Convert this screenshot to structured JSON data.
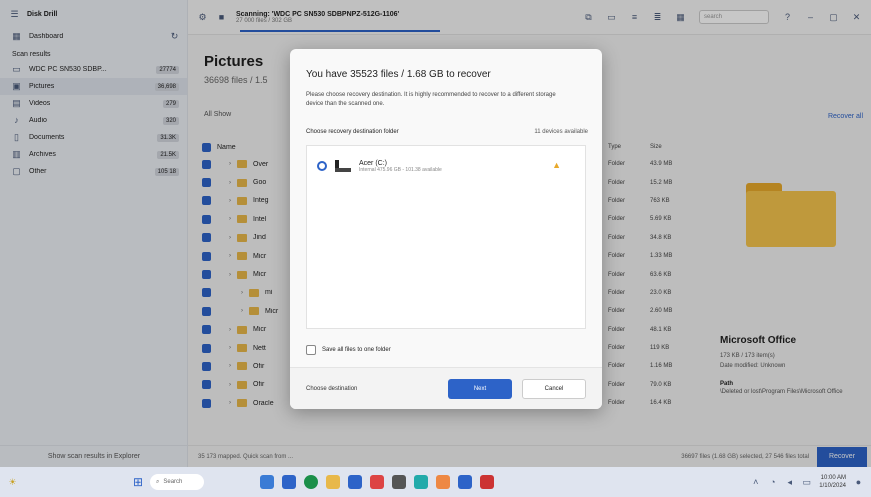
{
  "app": {
    "name": "Disk Drill",
    "scan_title": "Scanning: 'WDC PC SN530 SDBPNPZ-512G-1106'",
    "scan_subtitle": "27 000 files / 302 GB",
    "search_placeholder": "search"
  },
  "sidebar": {
    "dashboard_label": "Dashboard",
    "scan_results_heading": "Scan results",
    "items": [
      {
        "label": "WDC PC SN530 SDBP...",
        "count": "27774",
        "icon": "drive-icon"
      },
      {
        "label": "Pictures",
        "count": "36,698",
        "icon": "pictures-icon"
      },
      {
        "label": "Videos",
        "count": "279",
        "icon": "video-icon"
      },
      {
        "label": "Audio",
        "count": "320",
        "icon": "audio-icon"
      },
      {
        "label": "Documents",
        "count": "31.3K",
        "icon": "document-icon"
      },
      {
        "label": "Archives",
        "count": "21.5K",
        "icon": "archive-icon"
      },
      {
        "label": "Other",
        "count": "105 18",
        "icon": "other-icon"
      }
    ],
    "bottom_label": "Show scan results in Explorer"
  },
  "main": {
    "title": "Pictures",
    "subtitle": "36698 files / 1.5",
    "view_label": "All Show",
    "col_name": "Name",
    "col_type": "Type",
    "col_size": "Size",
    "rows": [
      {
        "name": "Over",
        "type": "Folder",
        "size": "43.9 MB"
      },
      {
        "name": "Goo",
        "type": "Folder",
        "size": "15.2 MB"
      },
      {
        "name": "Integ",
        "type": "Folder",
        "size": "763 KB"
      },
      {
        "name": "Intel",
        "type": "Folder",
        "size": "5.69 KB"
      },
      {
        "name": "Jind",
        "type": "Folder",
        "size": "34.8 KB"
      },
      {
        "name": "Micr",
        "type": "Folder",
        "size": "1.33 MB"
      },
      {
        "name": "Micr",
        "type": "Folder",
        "size": "63.6 KB"
      },
      {
        "name": "mi",
        "type": "Folder",
        "size": "23.0 KB"
      },
      {
        "name": "Micr",
        "type": "Folder",
        "size": "2.60 MB"
      },
      {
        "name": "Micr",
        "type": "Folder",
        "size": "48.1 KB"
      },
      {
        "name": "Nett",
        "type": "Folder",
        "size": "119 KB"
      },
      {
        "name": "Ofir",
        "type": "Folder",
        "size": "1.16 MB"
      },
      {
        "name": "Ofir",
        "type": "Folder",
        "size": "79.0 KB"
      },
      {
        "name": "Oracle",
        "type": "Folder",
        "size": "16.4 KB"
      }
    ]
  },
  "right_pane": {
    "recover_all_label": "Recover all",
    "folder_title": "Microsoft Office",
    "meta_1": "173 KB / 173 item(s)",
    "meta_2": "Date modified: Unknown",
    "path_label": "Path",
    "path_value": "\\Deleted or lost\\Program Files\\Microsoft Office"
  },
  "statusbar": {
    "left": "35 173 mapped. Quick scan from ...",
    "right": "36697 files (1.68 GB) selected, 27 546 files total",
    "recover_label": "Recover"
  },
  "dialog": {
    "title": "You have 35523 files / 1.68 GB to recover",
    "description": "Please choose recovery destination. It is highly recommended to recover to a different storage device than the scanned one.",
    "choose_label": "Choose recovery destination folder",
    "devices_count": "11 devices available",
    "destination": {
      "name": "Acer (C:)",
      "detail": "Internal 475.96 GB - 101.38 available"
    },
    "save_all_label": "Save all files to one folder",
    "choose_destination_label": "Choose destination",
    "next_label": "Next",
    "cancel_label": "Cancel"
  },
  "taskbar": {
    "search_label": "Search",
    "time": "10:00 AM",
    "date": "1/10/2024"
  },
  "colors": {
    "accent": "#2d63c8",
    "folder": "#f5c44e",
    "warning": "#e8a92b"
  }
}
